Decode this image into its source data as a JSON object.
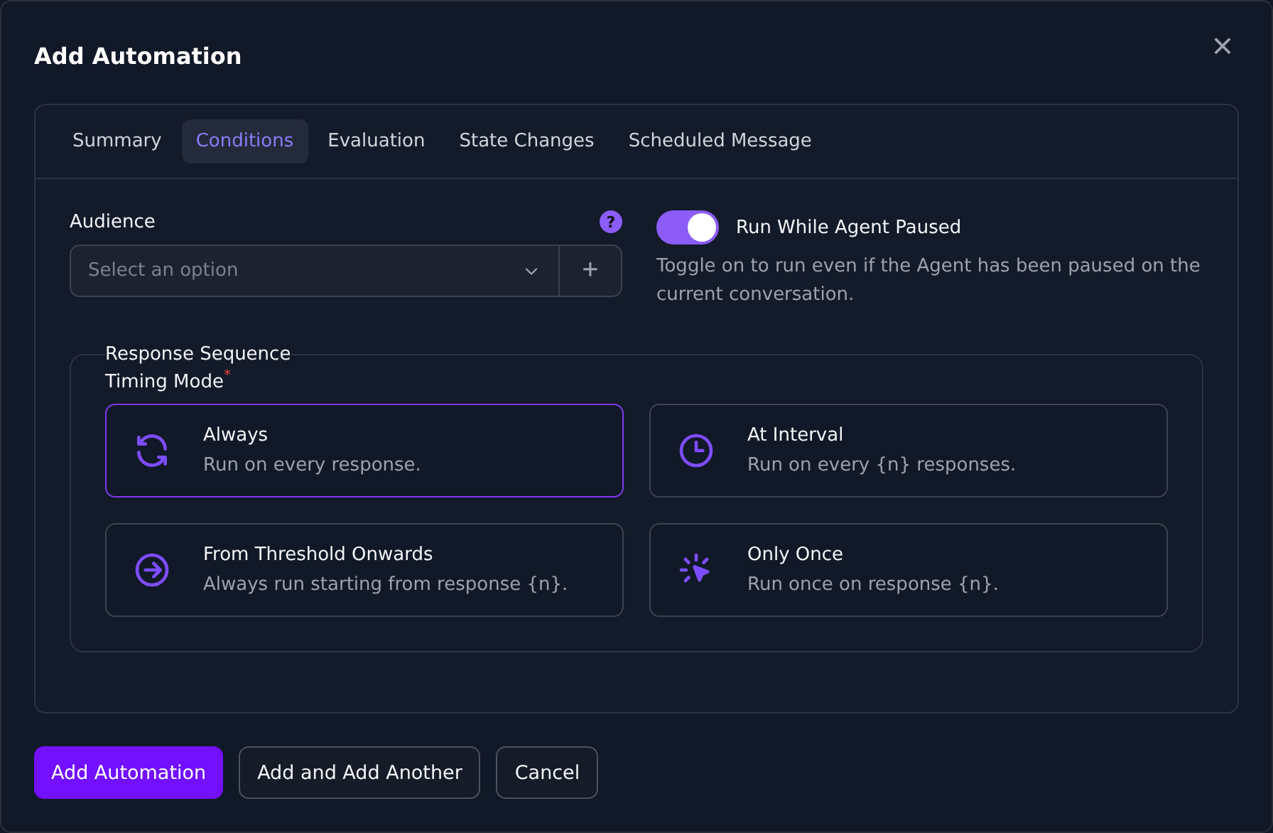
{
  "dialog": {
    "title": "Add Automation",
    "close": "×",
    "tabs": [
      {
        "label": "Summary",
        "selected": false
      },
      {
        "label": "Conditions",
        "selected": true
      },
      {
        "label": "Evaluation",
        "selected": false
      },
      {
        "label": "State Changes",
        "selected": false
      },
      {
        "label": "Scheduled Message",
        "selected": false
      }
    ],
    "audience": {
      "label": "Audience",
      "help": "?",
      "placeholder": "Select an option",
      "add": "+"
    },
    "run_while_paused": {
      "label": "Run While Agent Paused",
      "on": true,
      "description": "Toggle on to run even if the Agent has been paused on the current conversation."
    },
    "response_sequence": {
      "legend": "Response Sequence",
      "timing_mode_label": "Timing Mode",
      "required_mark": "*",
      "options": [
        {
          "kind": "always",
          "title": "Always",
          "description": "Run on every response.",
          "selected": true
        },
        {
          "kind": "interval",
          "title": "At Interval",
          "description": "Run on every {n} responses.",
          "selected": false
        },
        {
          "kind": "threshold",
          "title": "From Threshold Onwards",
          "description": "Always run starting from response {n}.",
          "selected": false
        },
        {
          "kind": "once",
          "title": "Only Once",
          "description": "Run once on response {n}.",
          "selected": false
        }
      ]
    },
    "buttons": [
      {
        "label": "Add Automation",
        "kind": "primary"
      },
      {
        "label": "Add and Add Another",
        "kind": "secondary"
      },
      {
        "label": "Cancel",
        "kind": "secondary"
      }
    ]
  }
}
